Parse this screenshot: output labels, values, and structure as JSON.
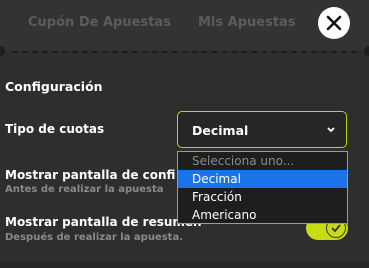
{
  "tabs": [
    "Cupón De Apuestas",
    "Mis Apuestas"
  ],
  "settings": {
    "section_title": "Configuración",
    "odds_label": "Tipo de cuotas",
    "odds_selected": "Decimal",
    "odds_options": [
      "Selecciona uno...",
      "Decimal",
      "Fracción",
      "Americano"
    ],
    "confirm_label": "Mostrar pantalla de confi",
    "confirm_sub": "Antes de realizar la apuesta",
    "summary_label": "Mostrar pantalla de resumen",
    "summary_sub": "Después de realizar la apuesta.",
    "summary_toggle_on": true
  },
  "colors": {
    "accent": "#c8dc14",
    "highlight": "#1a73e8",
    "background": "#2e2e2e"
  },
  "icons": [
    "close-icon",
    "chevron-down-icon",
    "check-icon"
  ]
}
